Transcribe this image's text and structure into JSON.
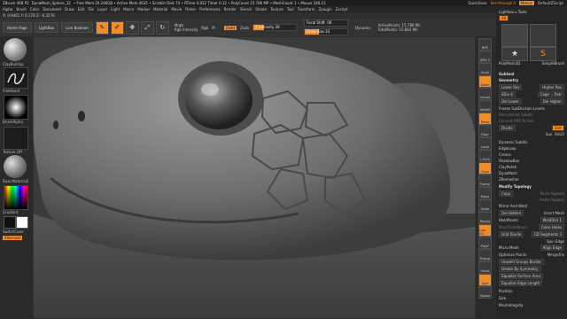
{
  "titlebar": {
    "title": "ZBrush 4R8 P2",
    "doc": "DynaMesh_Sphere_32",
    "stats": "• Free Mem 20.246GB • Active Mem 4635 • Scratch Disk 74 • RTime 0.912 Timer 0.12 • PolyCount 15.786 MP • MeshCount 1 • Mouse 180,15",
    "quicksave": "QuickSave",
    "seethrough": "See-through 0",
    "menus_label": "Menus",
    "defaultscript": "DefaultZScript"
  },
  "menubar": [
    "Alpha",
    "Brush",
    "Color",
    "Document",
    "Draw",
    "Edit",
    "File",
    "Layer",
    "Light",
    "Macro",
    "Marker",
    "Material",
    "Movie",
    "Picker",
    "Preferences",
    "Render",
    "Stencil",
    "Stroke",
    "Texture",
    "Tool",
    "Transform",
    "Zplugin",
    "Zscript"
  ],
  "infobar": "X: 0.9461 Y: 0.178 Z: -0.3276",
  "toolbar": {
    "home_page": "Home Page",
    "lightbox": "LightBox",
    "live_boolean": "Live Boolean",
    "edit": "Edit",
    "draw": "Draw",
    "move": "Move",
    "scale": "Scale",
    "rotate": "Rotate",
    "mrgb": "Mrgb",
    "rgb": "Rgb",
    "m": "M",
    "rgb_intensity": "Rgb Intensity",
    "zadd": "Zadd",
    "zsub": "Zsub",
    "z_intensity": "Z Intensity 26",
    "focal_shift": "Focal Shift -56",
    "draw_size": "Draw Size 33",
    "dynamic": "Dynamic",
    "active_points": "ActivePoints: 15.786 Mil",
    "total_points": "TotalPoints: 15.802 Mil"
  },
  "sliders": {
    "z_intensity": 0.26,
    "draw_size": 0.33
  },
  "leftshelf": {
    "brush_name": "ClayBuildup",
    "stroke_name": "FreeHand",
    "alpha_name": "BrushAlpha",
    "texture_name": "Texture Off",
    "material_name": "BasicMaterial2",
    "gradient": "Gradient",
    "switch_color": "SwitchColor",
    "alternate": "Alternate"
  },
  "rightshelf": [
    "BPR",
    "SPix 3",
    "Scroll",
    "Zoom",
    "Actual",
    "AAHalf",
    "Persp",
    "Floor",
    "Local",
    "L.Sym",
    "Gxyz",
    "Frame",
    "Move",
    "Scale",
    "Rotate",
    "Line Fill",
    "PolyF",
    "Transp",
    "Ghost",
    "Solo",
    "Xpose"
  ],
  "tray": {
    "lightbox_tools": "Lightbox ▸ Tools",
    "tool_count": "48",
    "thumb1": "DynaMesh_Sphere_32",
    "thumb2": "PolyMesh3D",
    "thumb3": "SimpleBrush",
    "subtool": "Subtool",
    "geometry": "Geometry",
    "lower_res": "Lower Res",
    "higher_res": "Higher Res",
    "sdiv": "SDiv 6",
    "cage": "Cage",
    "rstr": "Rstr",
    "del_lower": "Del Lower",
    "del_higher": "Del Higher",
    "freeze_subdiv": "Freeze SubDivision Levels",
    "reconstruct_subdiv": "Reconstruct Subdiv",
    "convert_bpr": "Convert BPR To Geo",
    "divide": "Divide",
    "smt": "Smt",
    "suv": "Suv",
    "relt": "ReUV",
    "dynamic_subdiv": "Dynamic Subdiv",
    "edgeloop": "EdgeLoop",
    "crease": "Crease",
    "shadowbox": "ShadowBox",
    "claypolish": "ClayPolish",
    "dynamesh": "DynaMesh",
    "zremesher": "ZRemesher",
    "modify_topology": "Modify Topology",
    "copy": "Copy",
    "paste_append": "Paste Append",
    "paste_replace": "Paste Replace",
    "mirror_weld": "Mirror And Weld",
    "del_hidden": "Del Hidden",
    "insert_mesh": "Insert Mesh",
    "weld_points": "WeldPoints",
    "weld_dist": "WeldDist 1",
    "meshfromrafters": "MeshFromBrush",
    "close_holes": "Close Holes",
    "grid_divide": "Grid Divide",
    "gd_segments": "GD Segments 3",
    "spin_edge": "Spin Edge",
    "micro_mesh": "Micro Mesh",
    "align_edge": "Align Edge",
    "optimize_points": "Optimize Points",
    "merge_tris": "MergeTris",
    "unweld_groups": "Unweld Groups Border",
    "delete_symmetry": "Delete By Symmetry",
    "equalize_surface": "Equalize Surface Area",
    "equalize_edge": "Equalize Edge Length",
    "position": "Position",
    "size": "Size",
    "meshintegrity": "MeshIntegrity"
  },
  "colors": {
    "accent": "#f28c28",
    "bg": "#2b2b2b",
    "panel": "#262626"
  }
}
